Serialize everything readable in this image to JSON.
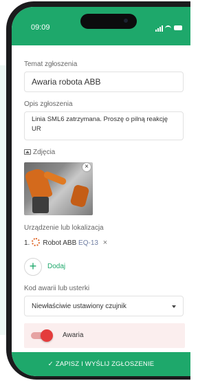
{
  "status_bar": {
    "time": "09:09"
  },
  "form": {
    "title_label": "Temat zgłoszenia",
    "title_value": "Awaria robota ABB",
    "desc_label": "Opis zgłoszenia",
    "desc_value": "Linia SML6 zatrzymana. Proszę o pilną reakcję UR",
    "photos_label": "Zdjęcia",
    "photo_close": "×",
    "device_label": "Urządzenie lub lokalizacja",
    "device": {
      "index": "1.",
      "name": "Robot ABB",
      "code": "EQ-13",
      "remove": "×"
    },
    "add_label": "Dodaj",
    "add_symbol": "+",
    "fault_code_label": "Kod awarii lub usterki",
    "fault_code_value": "Niewłaściwie ustawiony czujnik",
    "toggle_label": "Awaria",
    "toggle_on": true,
    "submit_label": "ZAPISZ I WYŚLIJ ZGŁOSZENIE",
    "submit_icon": "✓"
  },
  "colors": {
    "accent": "#1ea86b",
    "toggle_on": "#e43c3c",
    "toggle_bg": "#fbeeee",
    "device_code": "#6f7ea3"
  }
}
